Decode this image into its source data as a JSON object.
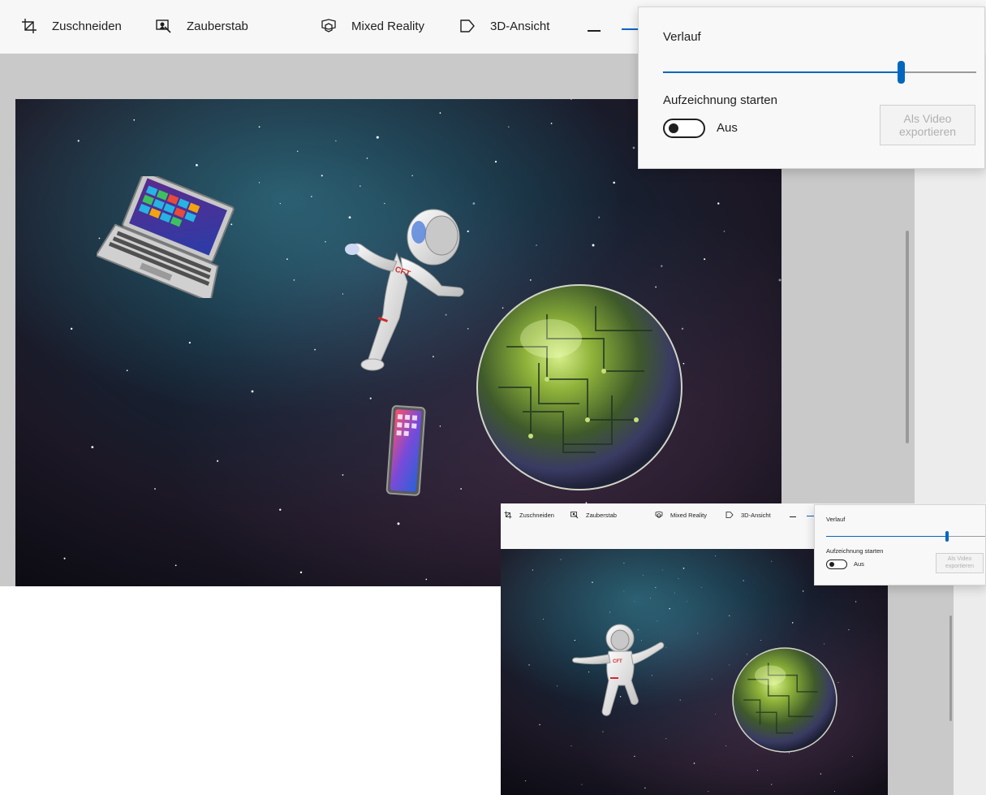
{
  "colors": {
    "accent": "#0067c0",
    "toolbar_bg": "#f7f7f7",
    "flyout_bg": "#f8f8f8",
    "canvas_bg": "#c9c9c9",
    "toggle_off": "#1f1f1f",
    "disabled_text": "#b0b0b0"
  },
  "toolbar": {
    "crop_label": "Zuschneiden",
    "magic_wand_label": "Zauberstab",
    "mixed_reality_label": "Mixed Reality",
    "view_3d_label": "3D-Ansicht",
    "icons": [
      "crop-icon",
      "magic-select-icon",
      "mixed-reality-icon",
      "3d-view-icon"
    ]
  },
  "flyout": {
    "history_label": "Verlauf",
    "history_position": 0.76,
    "record_label": "Aufzeichnung starten",
    "toggle_state_label": "Aus",
    "toggle_on": false,
    "export_label": "Als Video exportieren"
  },
  "scene": {
    "objects": [
      "laptop",
      "astronaut",
      "circuit-globe",
      "smartphone"
    ],
    "inset_objects": [
      "astronaut",
      "circuit-globe"
    ]
  }
}
